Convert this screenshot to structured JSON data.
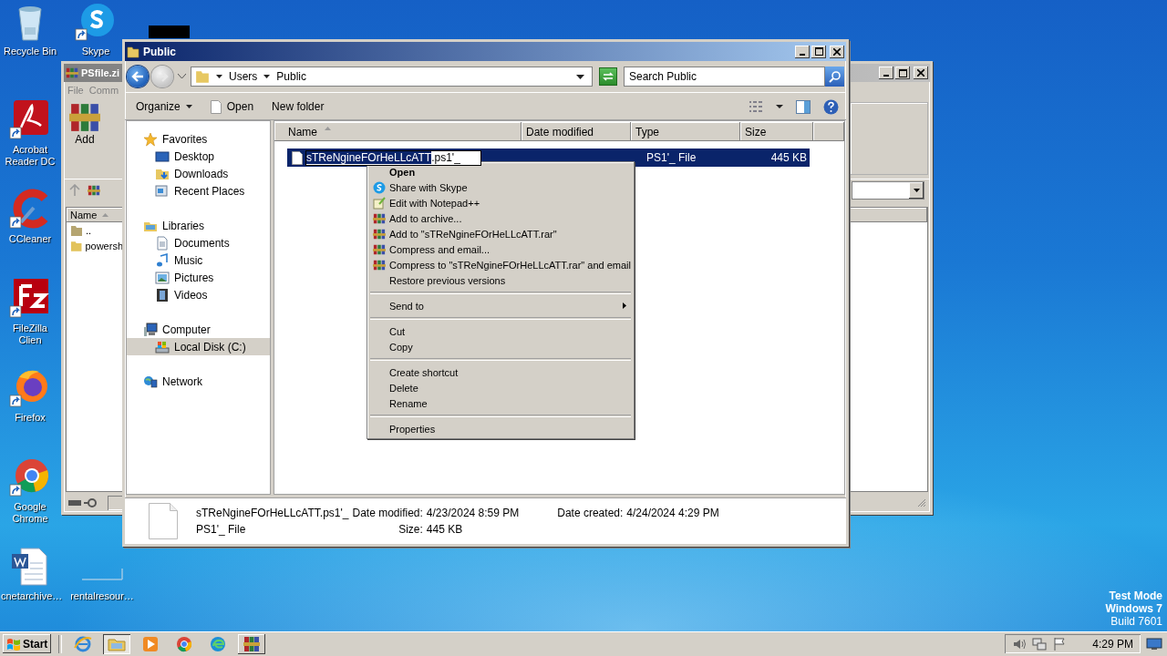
{
  "desktop_icons": [
    {
      "label": "Recycle Bin",
      "kind": "recycle"
    },
    {
      "label": "Skype",
      "kind": "skype"
    },
    {
      "label": "Acrobat Reader DC",
      "kind": "pdf"
    },
    {
      "label": "CCleaner",
      "kind": "ccleaner"
    },
    {
      "label": "FileZilla Clien",
      "kind": "filezilla"
    },
    {
      "label": "Firefox",
      "kind": "firefox"
    },
    {
      "label": "Google Chrome",
      "kind": "chrome"
    },
    {
      "label": "cnetarchive…",
      "kind": "word"
    },
    {
      "label": "rentalresour…",
      "kind": "blank"
    }
  ],
  "back_window": {
    "title": "PSfile.zi",
    "menu": [
      "File",
      "Comm"
    ],
    "toolbar": [
      "Add"
    ],
    "columns": [
      "Name"
    ],
    "rows": [
      {
        "name": "..",
        "kind": "parent"
      },
      {
        "name": "powersh",
        "kind": "folder"
      }
    ]
  },
  "window": {
    "title": "Public",
    "breadcrumb": [
      "Users",
      "Public"
    ],
    "search": {
      "placeholder": "Search Public"
    },
    "toolbar": [
      {
        "label": "Organize",
        "kind": "menu"
      },
      {
        "label": "Open",
        "kind": "open"
      },
      {
        "label": "New folder",
        "kind": "plain"
      }
    ],
    "nav": [
      {
        "label": "Favorites",
        "kind": "star",
        "selected": false,
        "children": [
          {
            "label": "Desktop",
            "kind": "desktop",
            "selected": false
          },
          {
            "label": "Downloads",
            "kind": "downloads",
            "selected": false
          },
          {
            "label": "Recent Places",
            "kind": "recent",
            "selected": false
          }
        ]
      },
      {
        "label": "Libraries",
        "kind": "library",
        "selected": false,
        "children": [
          {
            "label": "Documents",
            "kind": "documents",
            "selected": false
          },
          {
            "label": "Music",
            "kind": "music",
            "selected": false
          },
          {
            "label": "Pictures",
            "kind": "pictures",
            "selected": false
          },
          {
            "label": "Videos",
            "kind": "videos",
            "selected": false
          }
        ]
      },
      {
        "label": "Computer",
        "kind": "computer",
        "selected": false,
        "children": [
          {
            "label": "Local Disk (C:)",
            "kind": "disk",
            "selected": true
          }
        ]
      },
      {
        "label": "Network",
        "kind": "network",
        "selected": false
      }
    ],
    "columns": [
      "Name",
      "Date modified",
      "Type",
      "Size"
    ],
    "files": [
      {
        "name_selected": "sTReNgineFOrHeLLcATT",
        "name_rest": ".ps1'_",
        "type": "PS1'_ File",
        "size": "445 KB",
        "selected": true,
        "renaming": true
      }
    ],
    "context_menu": [
      {
        "label": "Open",
        "kind": "default"
      },
      {
        "label": "Share with Skype",
        "kind": "skype"
      },
      {
        "label": "Edit with Notepad++",
        "kind": "notepad"
      },
      {
        "label": "Add to archive...",
        "kind": "archive"
      },
      {
        "label": "Add to \"sTReNgineFOrHeLLcATT.rar\"",
        "kind": "archive"
      },
      {
        "label": "Compress and email...",
        "kind": "archive"
      },
      {
        "label": "Compress to \"sTReNgineFOrHeLLcATT.rar\" and email",
        "kind": "archive"
      },
      {
        "label": "Restore previous versions",
        "kind": "plain"
      },
      {
        "kind": "separator"
      },
      {
        "label": "Send to",
        "kind": "submenu"
      },
      {
        "kind": "separator"
      },
      {
        "label": "Cut",
        "kind": "plain"
      },
      {
        "label": "Copy",
        "kind": "plain"
      },
      {
        "kind": "separator"
      },
      {
        "label": "Create shortcut",
        "kind": "plain"
      },
      {
        "label": "Delete",
        "kind": "plain"
      },
      {
        "label": "Rename",
        "kind": "plain"
      },
      {
        "kind": "separator"
      },
      {
        "label": "Properties",
        "kind": "plain"
      }
    ],
    "details": {
      "name": "sTReNgineFOrHeLLcATT.ps1'_",
      "type": "PS1'_ File",
      "date_modified": {
        "label": "Date modified:",
        "value": "4/23/2024 8:59 PM"
      },
      "size": {
        "label": "Size:",
        "value": "445 KB"
      },
      "date_created": {
        "label": "Date created:",
        "value": "4/24/2024 4:29 PM"
      }
    }
  },
  "os_notice": [
    "Test Mode",
    "Windows 7",
    "Build 7601"
  ],
  "taskbar": {
    "start": "Start",
    "clock": "4:29 PM",
    "apps": [
      {
        "kind": "ie",
        "open": false,
        "selected": false
      },
      {
        "kind": "explorer",
        "open": true,
        "selected": true
      },
      {
        "kind": "media",
        "open": false,
        "selected": false
      },
      {
        "kind": "chrome",
        "open": false,
        "selected": false
      },
      {
        "kind": "edge",
        "open": false,
        "selected": false
      },
      {
        "kind": "winrar",
        "open": true,
        "selected": false
      }
    ]
  }
}
